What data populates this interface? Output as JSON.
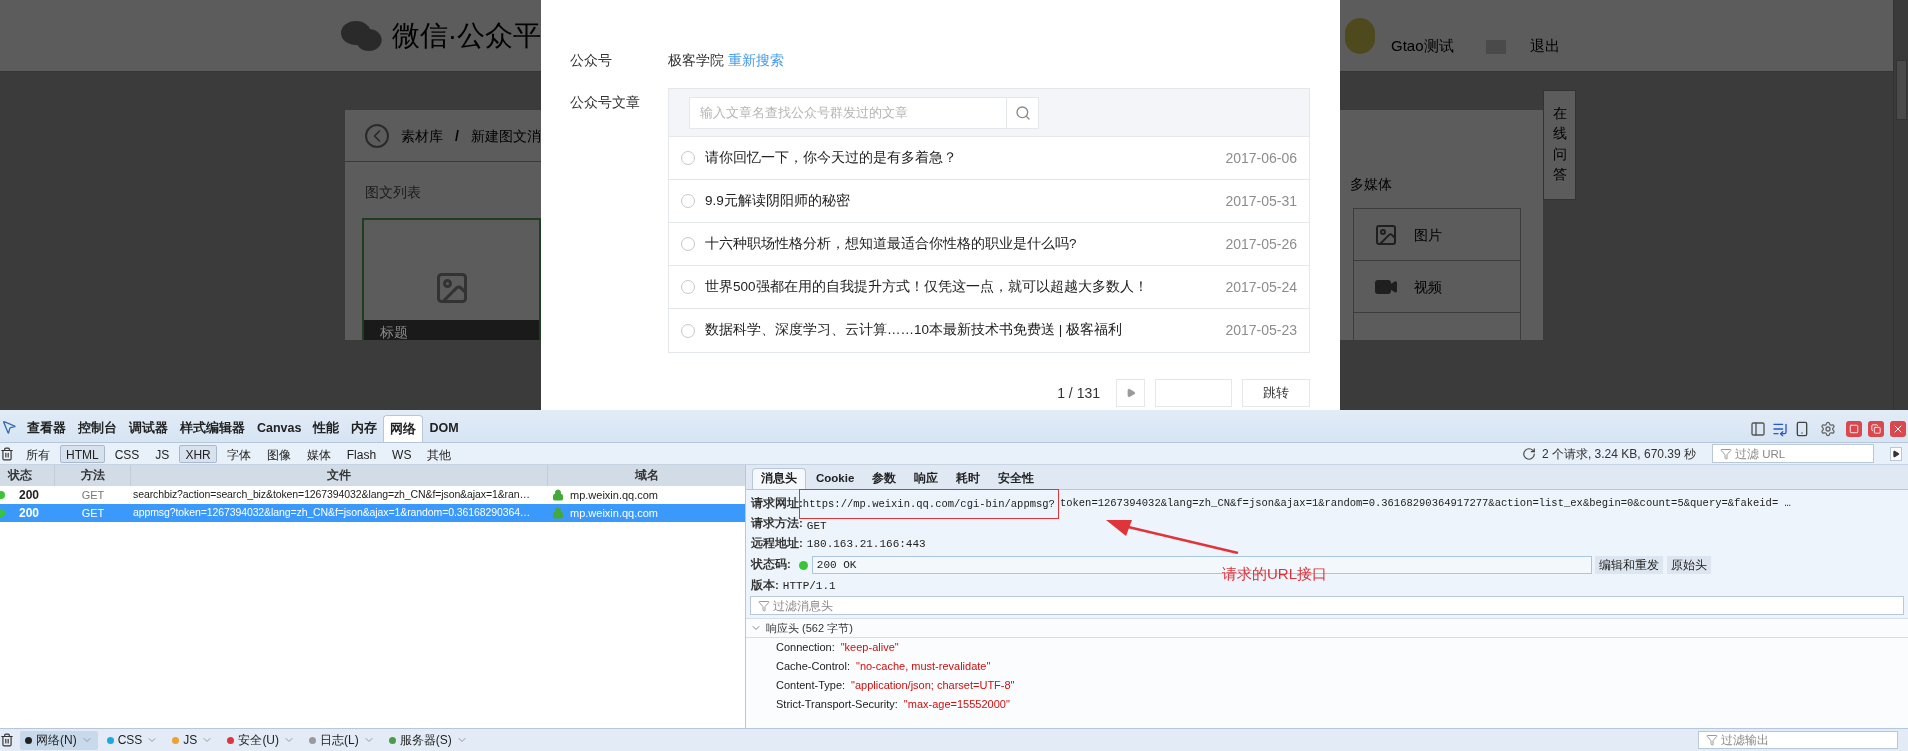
{
  "background_page": {
    "logo_text": "微信·公众平",
    "account_name": "Gtao测试",
    "logout": "退出",
    "breadcrumb": [
      "素材库",
      "新建图文消"
    ],
    "breadcrumb_separator": "/",
    "section_title": "图文列表",
    "card_caption": "标题",
    "media_title": "多媒体",
    "media_items": [
      {
        "label": "图片",
        "kind": "image"
      },
      {
        "label": "视频",
        "kind": "video"
      }
    ],
    "help_tab": "在线问答"
  },
  "modal": {
    "account_label": "公众号",
    "account_value": "极客学院",
    "research_link": "重新搜索",
    "articles_label": "公众号文章",
    "search": {
      "placeholder": "输入文章名查找公众号群发过的文章"
    },
    "articles": [
      {
        "title": "请你回忆一下，你今天过的是有多着急？",
        "date": "2017-06-06",
        "selected": false
      },
      {
        "title": "9.9元解读阴阳师的秘密",
        "date": "2017-05-31",
        "selected": false
      },
      {
        "title": "十六种职场性格分析，想知道最适合你性格的职业是什么吗?",
        "date": "2017-05-26",
        "selected": false
      },
      {
        "title": "世界500强都在用的自我提升方式！仅凭这一点，就可以超越大多数人！",
        "date": "2017-05-24",
        "selected": false
      },
      {
        "title": "数据科学、深度学习、云计算……10本最新技术书免费送 | 极客福利",
        "date": "2017-05-23",
        "selected": false
      }
    ],
    "pagination": {
      "page": "1 / 131",
      "jump_button": "跳转"
    }
  },
  "devtools": {
    "tabs": [
      {
        "label": "查看器",
        "selected": false
      },
      {
        "label": "控制台",
        "selected": false
      },
      {
        "label": "调试器",
        "selected": false
      },
      {
        "label": "样式编辑器",
        "selected": false
      },
      {
        "label": "Canvas",
        "selected": false
      },
      {
        "label": "性能",
        "selected": false
      },
      {
        "label": "内存",
        "selected": false
      },
      {
        "label": "网络",
        "selected": true
      },
      {
        "label": "DOM",
        "selected": false
      }
    ],
    "filters": [
      {
        "label": "所有",
        "selected": false
      },
      {
        "label": "HTML",
        "selected": true
      },
      {
        "label": "CSS",
        "selected": false
      },
      {
        "label": "JS",
        "selected": false
      },
      {
        "label": "XHR",
        "selected": true
      },
      {
        "label": "字体",
        "selected": false
      },
      {
        "label": "图像",
        "selected": false
      },
      {
        "label": "媒体",
        "selected": false
      },
      {
        "label": "Flash",
        "selected": false
      },
      {
        "label": "WS",
        "selected": false
      },
      {
        "label": "其他",
        "selected": false
      }
    ],
    "summary": "2 个请求, 3.24 KB, 670.39 秒",
    "url_filter": {
      "placeholder": "过滤 URL"
    },
    "columns": [
      "状态",
      "方法",
      "文件",
      "域名"
    ],
    "requests": [
      {
        "status": "200",
        "method": "GET",
        "file": "searchbiz?action=search_biz&token=1267394032&lang=zh_CN&f=json&ajax=1&ran…",
        "domain": "mp.weixin.qq.com",
        "selected": false
      },
      {
        "status": "200",
        "method": "GET",
        "file": "appmsg?token=1267394032&lang=zh_CN&f=json&ajax=1&random=0.36168290364…",
        "domain": "mp.weixin.qq.com",
        "selected": true
      }
    ],
    "detail_tabs": [
      {
        "label": "消息头",
        "selected": true
      },
      {
        "label": "Cookie",
        "selected": false
      },
      {
        "label": "参数",
        "selected": false
      },
      {
        "label": "响应",
        "selected": false
      },
      {
        "label": "耗时",
        "selected": false
      },
      {
        "label": "安全性",
        "selected": false
      }
    ],
    "request_url": {
      "label": "请求网址:",
      "highlighted_part": "https://mp.weixin.qq.com/cgi-bin/appmsg?",
      "rest": "token=1267394032&lang=zh_CN&f=json&ajax=1&random=0.36168290364917277&action=list_ex&begin=0&count=5&query=&fakeid= …"
    },
    "request_method": {
      "label": "请求方法:",
      "value": "GET"
    },
    "remote_address": {
      "label": "远程地址:",
      "value": "180.163.21.166:443"
    },
    "status_code": {
      "label": "状态码:",
      "value": "200 OK"
    },
    "status_buttons": [
      "编辑和重发",
      "原始头"
    ],
    "version": {
      "label": "版本:",
      "value": "HTTP/1.1"
    },
    "header_filter": {
      "placeholder": "过滤消息头"
    },
    "response_headers": {
      "title": "响应头 (562 字节)",
      "expanded": true,
      "items": [
        {
          "name": "Connection:",
          "value": "\"keep-alive\""
        },
        {
          "name": "Cache-Control:",
          "value": "\"no-cache, must-revalidate\""
        },
        {
          "name": "Content-Type:",
          "value": "\"application/json; charset=UTF-8\""
        },
        {
          "name": "Strict-Transport-Security:",
          "value": "\"max-age=15552000\""
        }
      ]
    },
    "annotation": "请求的URL接口",
    "console_tabs": [
      {
        "label": "网络(N)",
        "color": "#222222",
        "selected": true
      },
      {
        "label": "CSS",
        "color": "#1ea7e1",
        "selected": false
      },
      {
        "label": "JS",
        "color": "#f0a030",
        "selected": false
      },
      {
        "label": "安全(U)",
        "color": "#e0343c",
        "selected": false
      },
      {
        "label": "日志(L)",
        "color": "#9a9a9a",
        "selected": false
      },
      {
        "label": "服务器(S)",
        "color": "#4c9a4c",
        "selected": false
      }
    ],
    "output_filter": {
      "placeholder": "过滤输出"
    }
  }
}
